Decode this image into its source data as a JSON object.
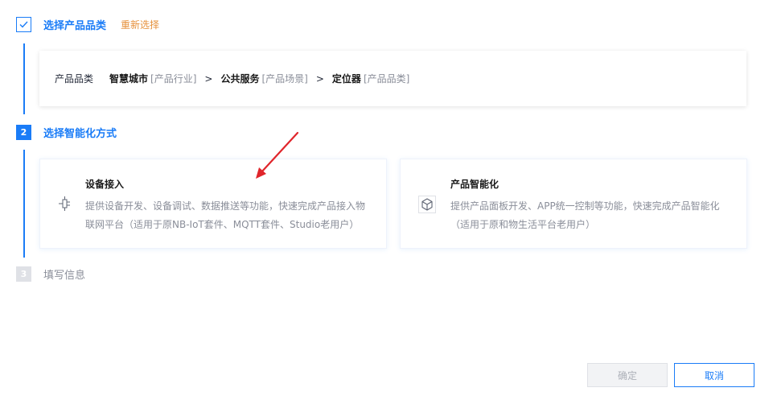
{
  "steps": [
    {
      "number": "1",
      "title": "选择产品品类",
      "state": "done",
      "action": "重新选择"
    },
    {
      "number": "2",
      "title": "选择智能化方式",
      "state": "active"
    },
    {
      "number": "3",
      "title": "填写信息",
      "state": "pending"
    }
  ],
  "summary": {
    "label": "产品品类",
    "items": [
      {
        "name": "智慧城市",
        "type": "[产品行业]"
      },
      {
        "name": "公共服务",
        "type": "[产品场景]"
      },
      {
        "name": "定位器",
        "type": "[产品品类]"
      }
    ],
    "separator": ">"
  },
  "options": [
    {
      "title": "设备接入",
      "desc_line1": "提供设备开发、设备调试、数据推送等功能，快速完成产品接入物",
      "desc_line2": "联网平台（适用于原NB-IoT套件、MQTT套件、Studio老用户）",
      "icon": "device-connect-icon"
    },
    {
      "title": "产品智能化",
      "desc_line1": "提供产品面板开发、APP统一控制等功能，快速完成产品智能化",
      "desc_line2": "（适用于原和物生活平台老用户）",
      "icon": "cube-icon"
    }
  ],
  "buttons": {
    "ok": "确定",
    "cancel": "取消"
  },
  "colors": {
    "primary": "#1a7cf7",
    "accent": "#e6913c",
    "arrow": "#e0252b",
    "disabled": "#adb0b8"
  }
}
